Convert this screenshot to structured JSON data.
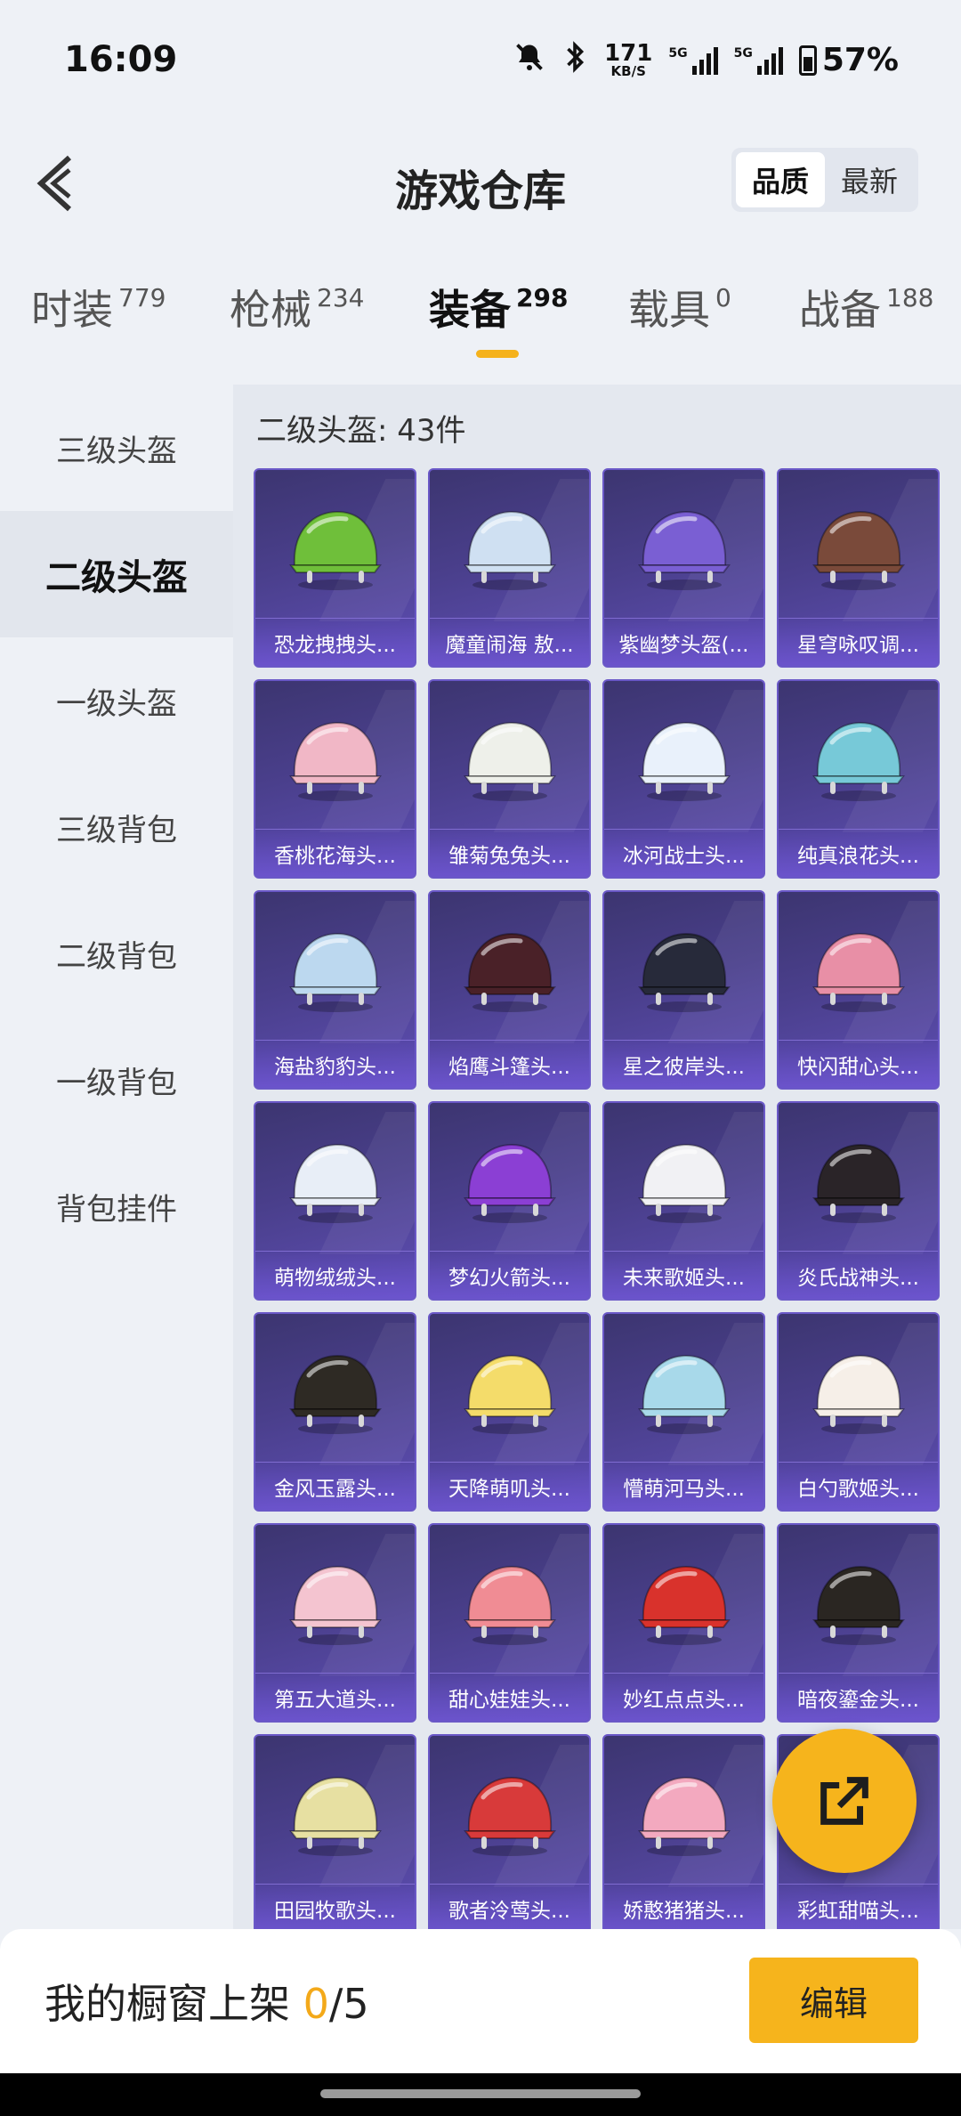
{
  "status": {
    "time": "16:09",
    "net_speed": "171",
    "net_unit": "KB/S",
    "sig1": "5G",
    "sig2": "5G",
    "battery": "57%",
    "icons": [
      "mute-icon",
      "bluetooth-icon",
      "signal-icon",
      "battery-icon"
    ]
  },
  "header": {
    "title": "游戏仓库",
    "sort_quality": "品质",
    "sort_latest": "最新"
  },
  "tabs": [
    {
      "name": "时装",
      "count": "779"
    },
    {
      "name": "枪械",
      "count": "234"
    },
    {
      "name": "装备",
      "count": "298"
    },
    {
      "name": "载具",
      "count": "0"
    },
    {
      "name": "战备",
      "count": "188"
    }
  ],
  "sidebar": {
    "items": [
      "三级头盔",
      "二级头盔",
      "一级头盔",
      "三级背包",
      "二级背包",
      "一级背包",
      "背包挂件"
    ]
  },
  "content": {
    "section_title": "二级头盔: 43件",
    "items": [
      {
        "name": "恐龙拽拽头...",
        "color": "#6fbf3a"
      },
      {
        "name": "魔童闹海 敖...",
        "color": "#cfe0f2"
      },
      {
        "name": "紫幽梦头盔(...",
        "color": "#7a5fd3"
      },
      {
        "name": "星穹咏叹调...",
        "color": "#7a4a3a"
      },
      {
        "name": "香桃花海头...",
        "color": "#f1b7c6"
      },
      {
        "name": "雏菊兔兔头...",
        "color": "#eef0ea"
      },
      {
        "name": "冰河战士头...",
        "color": "#e9f1fb"
      },
      {
        "name": "纯真浪花头...",
        "color": "#77c9d8"
      },
      {
        "name": "海盐豹豹头...",
        "color": "#bcd8ef"
      },
      {
        "name": "焰鹰斗篷头...",
        "color": "#4a2128"
      },
      {
        "name": "星之彼岸头...",
        "color": "#272a3a"
      },
      {
        "name": "快闪甜心头...",
        "color": "#e88fa6"
      },
      {
        "name": "萌物绒绒头...",
        "color": "#e8eef7"
      },
      {
        "name": "梦幻火箭头...",
        "color": "#8b3fd4"
      },
      {
        "name": "未来歌姬头...",
        "color": "#f1f1f4"
      },
      {
        "name": "炎氏战神头...",
        "color": "#2a2428"
      },
      {
        "name": "金风玉露头...",
        "color": "#2e2a24"
      },
      {
        "name": "天降萌叽头...",
        "color": "#f4dc6a"
      },
      {
        "name": "懵萌河马头...",
        "color": "#a8d9ea"
      },
      {
        "name": "白勺歌姬头...",
        "color": "#f6efe8"
      },
      {
        "name": "第五大道头...",
        "color": "#f4c4d0"
      },
      {
        "name": "甜心娃娃头...",
        "color": "#f08c94"
      },
      {
        "name": "妙红点点头...",
        "color": "#d9322c"
      },
      {
        "name": "暗夜鎏金头...",
        "color": "#2a2622"
      },
      {
        "name": "田园牧歌头...",
        "color": "#e7e0a2"
      },
      {
        "name": "歌者泠莺头...",
        "color": "#d83a3a"
      },
      {
        "name": "娇憨猪猪头...",
        "color": "#f3a9bf"
      },
      {
        "name": "彩虹甜喵头...",
        "color": "#f2d2e4"
      }
    ]
  },
  "bottom": {
    "shelf_prefix": "我的橱窗上架 ",
    "shelf_current": "0",
    "shelf_total": "/5",
    "edit_label": "编辑"
  },
  "theme": {
    "accent": "#f6b41c",
    "card": "#4a3f8c"
  }
}
